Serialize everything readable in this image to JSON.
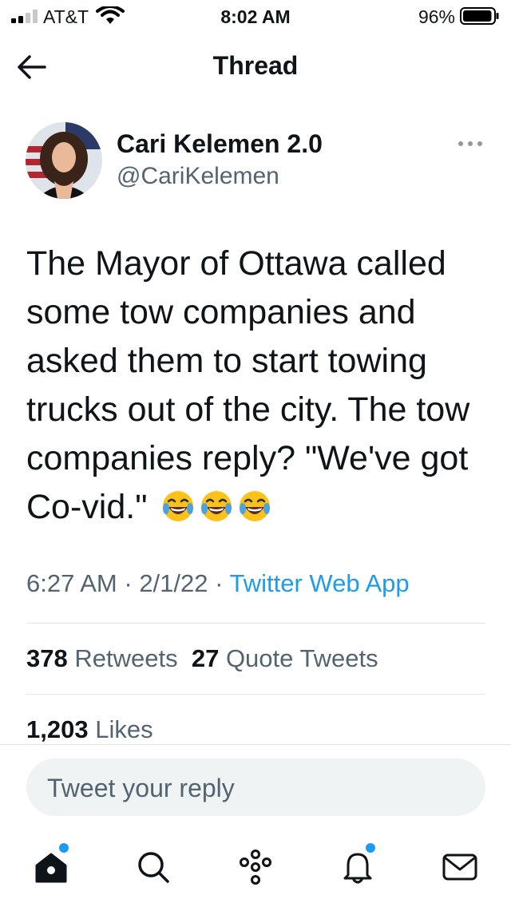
{
  "status_bar": {
    "carrier": "AT&T",
    "time": "8:02 AM",
    "battery_percent": "96%",
    "battery_level": 0.96,
    "icons": [
      "cell-signal-icon",
      "wifi-icon",
      "battery-icon"
    ]
  },
  "header": {
    "title": "Thread",
    "back_icon": "arrow-left-icon"
  },
  "tweet": {
    "author": {
      "name": "Cari Kelemen 2.0",
      "handle": "@CariKelemen"
    },
    "text": "The Mayor of Ottawa called some tow companies and asked them to start towing trucks out of the city. The tow companies reply? \"We've got Co-vid.\"",
    "emoji": [
      "face-with-tears-of-joy",
      "face-with-tears-of-joy",
      "face-with-tears-of-joy"
    ],
    "time": "6:27 AM",
    "separator": " · ",
    "date": "2/1/22",
    "source": "Twitter Web App",
    "retweets_count": "378",
    "retweets_label": "Retweets",
    "quotes_count": "27",
    "quotes_label": "Quote Tweets",
    "likes_count": "1,203",
    "likes_label": "Likes"
  },
  "reply": {
    "placeholder": "Tweet your reply",
    "value": ""
  },
  "bottom_nav": {
    "items": [
      "home-icon",
      "search-icon",
      "spaces-icon",
      "notifications-icon",
      "messages-icon"
    ]
  },
  "colors": {
    "accent": "#1d9bf0",
    "text_primary": "#0f1419",
    "text_secondary": "#536471",
    "divider": "#e3e6e8",
    "reply_bg": "#eff3f4"
  }
}
